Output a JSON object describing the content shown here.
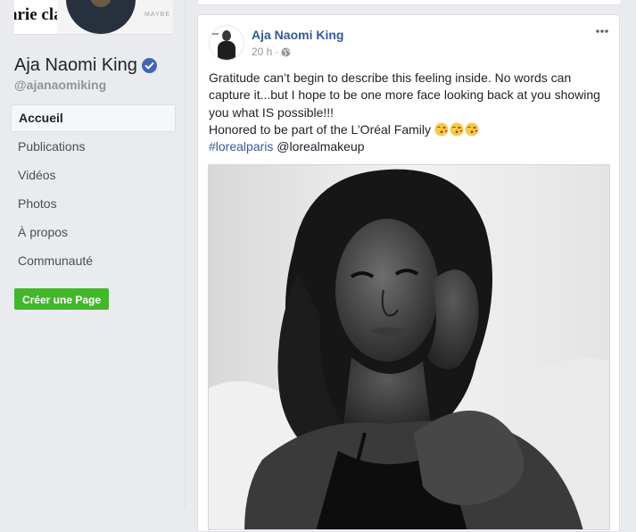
{
  "page": {
    "name": "Aja Naomi King",
    "handle": "@ajanaomiking",
    "cover_brand_left": "arie cla",
    "cover_brand_right": "MAYBE"
  },
  "nav": {
    "items": [
      {
        "label": "Accueil",
        "active": true
      },
      {
        "label": "Publications",
        "active": false
      },
      {
        "label": "Vidéos",
        "active": false
      },
      {
        "label": "Photos",
        "active": false
      },
      {
        "label": "À propos",
        "active": false
      },
      {
        "label": "Communauté",
        "active": false
      }
    ],
    "create_page_label": "Créer une Page"
  },
  "post": {
    "author": "Aja Naomi King",
    "time": "20 h",
    "meta_separator": "·",
    "options_icon": "more-options-icon",
    "audience_icon": "globe-icon",
    "text_paragraph_1": "Gratitude can’t begin to describe this feeling inside. No words can capture it...but I hope to be one more face looking back at you showing you what IS possible!!!",
    "text_line_2": "Honored to be part of the L’Oréal Family",
    "emojis": [
      "kiss-emoji",
      "kiss-emoji",
      "kiss-emoji"
    ],
    "hashtag": "#lorealparis",
    "mention": " @lorealmakeup",
    "photo": "black-and-white-portrait"
  },
  "colors": {
    "background": "#e9ebee",
    "link": "#365899",
    "create_button": "#42b72a",
    "verified": "#4267b2",
    "muted_text": "#90949c"
  }
}
